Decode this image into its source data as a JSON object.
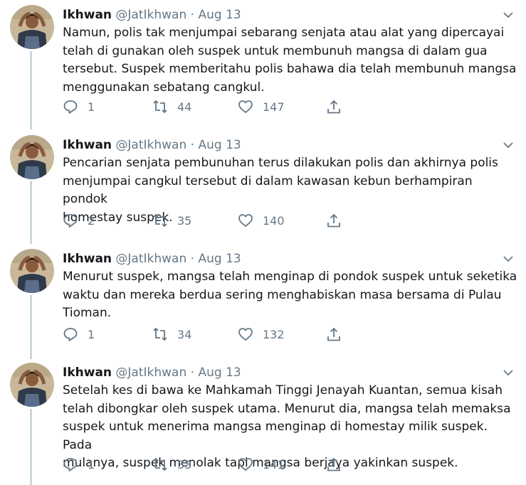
{
  "colors": {
    "name": "#14171a",
    "muted": "#657786",
    "thread": "#ccd6dd"
  },
  "icons": {
    "reply": "reply-icon",
    "retweet": "retweet-icon",
    "like": "heart-icon",
    "share": "share-icon",
    "menu": "chevron-down-icon"
  },
  "tweets": [
    {
      "name": "Ikhwan",
      "handle": "@JatIkhwan",
      "separator": "·",
      "date": "Aug 13",
      "text": "Namun, polis tak menjumpai sebarang senjata atau alat yang dipercayai\ntelah di gunakan oleh suspek untuk membunuh mangsa di dalam gua\ntersebut. Suspek memberitahu polis bahawa dia telah membunuh mangsa\nmenggunakan sebatang cangkul.",
      "replies": "1",
      "retweets": "44",
      "likes": "147"
    },
    {
      "name": "Ikhwan",
      "handle": "@JatIkhwan",
      "separator": "·",
      "date": "Aug 13",
      "text": "Pencarian senjata pembunuhan terus dilakukan polis dan akhirnya polis\nmenjumpai cangkul tersebut di dalam kawasan kebun berhampiran pondok\nhomestay suspek.",
      "replies": "2",
      "retweets": "35",
      "likes": "140"
    },
    {
      "name": "Ikhwan",
      "handle": "@JatIkhwan",
      "separator": "·",
      "date": "Aug 13",
      "text": "Menurut suspek, mangsa telah menginap di pondok suspek untuk seketika\nwaktu dan mereka berdua sering menghabiskan masa bersama di Pulau\nTioman.",
      "replies": "1",
      "retweets": "34",
      "likes": "132"
    },
    {
      "name": "Ikhwan",
      "handle": "@JatIkhwan",
      "separator": "·",
      "date": "Aug 13",
      "text": "Setelah kes di bawa ke Mahkamah Tinggi Jenayah Kuantan, semua kisah\ntelah dibongkar oleh suspek utama. Menurut dia, mangsa telah memaksa\nsuspek untuk menerima mangsa menginap di homestay milik suspek. Pada\nmulanya, suspek menolak tapi mangsa berjaya yakinkan suspek.",
      "replies": "1",
      "retweets": "33",
      "likes": "141"
    }
  ]
}
